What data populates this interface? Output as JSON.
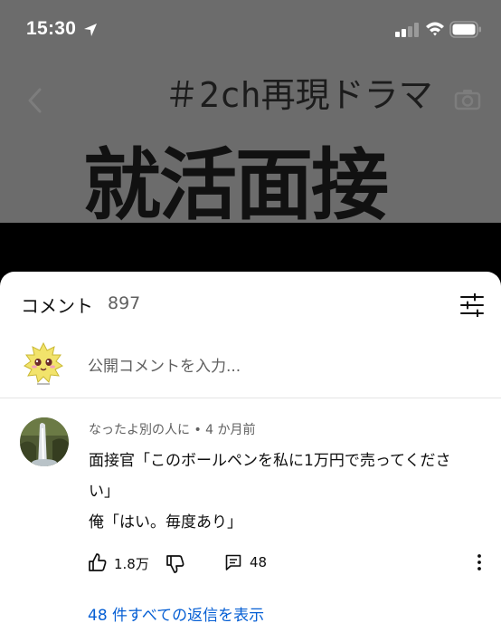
{
  "status_bar": {
    "time": "15:30"
  },
  "video": {
    "hashtag_title": "＃2ch再現ドラマ",
    "main_title": "就活面接"
  },
  "comments_panel": {
    "title": "コメント",
    "count": "897",
    "input_placeholder": "公開コメントを入力..."
  },
  "comment": {
    "author": "なったよ別の人に",
    "time_ago": "4 か月前",
    "lines": [
      "面接官「このボールペンを私に1万円で売ってくださ",
      "い」",
      "俺「はい。毎度あり」"
    ],
    "likes": "1.8万",
    "replies": "48",
    "show_replies_label": "48 件すべての返信を表示"
  },
  "colors": {
    "link_blue": "#065fd4",
    "secondary_text": "#606060",
    "primary_text": "#0f0f0f",
    "video_bg": "#6c6c6c"
  }
}
